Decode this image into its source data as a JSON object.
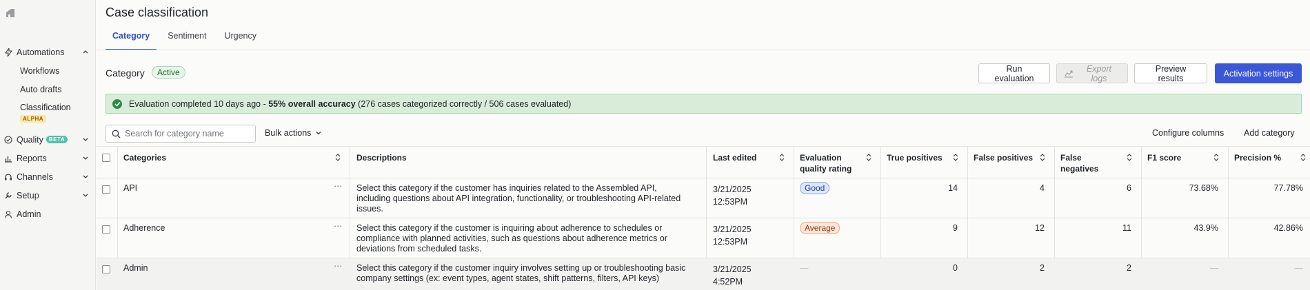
{
  "sidebar": {
    "items": [
      {
        "label": "Automations",
        "icon": "bolt-icon",
        "expanded": true
      },
      {
        "label": "Workflows"
      },
      {
        "label": "Auto drafts"
      },
      {
        "label": "Classification",
        "badge": "ALPHA"
      },
      {
        "label": "Quality",
        "icon": "quality-icon",
        "badge": "BETA"
      },
      {
        "label": "Reports",
        "icon": "chart-icon"
      },
      {
        "label": "Channels",
        "icon": "headset-icon"
      },
      {
        "label": "Setup",
        "icon": "wrench-icon"
      },
      {
        "label": "Admin",
        "icon": "person-icon"
      }
    ]
  },
  "page": {
    "title": "Case classification",
    "tabs": [
      "Category",
      "Sentiment",
      "Urgency"
    ],
    "active_tab": "Category"
  },
  "section": {
    "title": "Category",
    "status": "Active",
    "buttons": {
      "run": "Run evaluation",
      "export": "Export logs",
      "preview": "Preview results",
      "activation": "Activation settings"
    }
  },
  "banner": {
    "prefix": "Evaluation completed 10 days ago - ",
    "bold": "55% overall accuracy",
    "suffix": " (276 cases categorized correctly / 506 cases evaluated)"
  },
  "toolbar": {
    "search_placeholder": "Search for category name",
    "bulk_actions": "Bulk actions",
    "configure_columns": "Configure columns",
    "add_category": "Add category"
  },
  "table": {
    "headers": {
      "categories": "Categories",
      "descriptions": "Descriptions",
      "last_edited": "Last edited",
      "eval_rating_1": "Evaluation",
      "eval_rating_2": "quality rating",
      "true_pos": "True positives",
      "false_pos": "False positives",
      "false_neg_1": "False",
      "false_neg_2": "negatives",
      "f1": "F1 score",
      "precision": "Precision %"
    },
    "rows": [
      {
        "name": "API",
        "more": "···",
        "desc": [
          "Select this category if the customer has inquiries related to the Assembled API,",
          "including questions about API integration, functionality, or troubleshooting API-related",
          "issues."
        ],
        "date": "3/21/2025",
        "time": "12:53PM",
        "rating": "Good",
        "tp": "14",
        "fp": "4",
        "fn": "6",
        "f1": "73.68%",
        "precision": "77.78%"
      },
      {
        "name": "Adherence",
        "more": "···",
        "desc": [
          "Select this category if the customer is inquiring about adherence to schedules or",
          "compliance with planned activities, such as questions about adherence metrics or",
          "deviations from scheduled tasks."
        ],
        "date": "3/21/2025",
        "time": "12:53PM",
        "rating": "Average",
        "tp": "9",
        "fp": "12",
        "fn": "11",
        "f1": "43.9%",
        "precision": "42.86%"
      },
      {
        "name": "Admin",
        "more": "···",
        "desc": [
          "Select this category if the customer inquiry involves setting up or troubleshooting basic",
          "company settings (ex: event types, agent states, shift patterns, filters, API keys)"
        ],
        "date": "3/21/2025",
        "time": "4:52PM",
        "rating": "—",
        "tp": "0",
        "fp": "2",
        "fn": "2",
        "f1": "—",
        "precision": "—"
      }
    ]
  }
}
